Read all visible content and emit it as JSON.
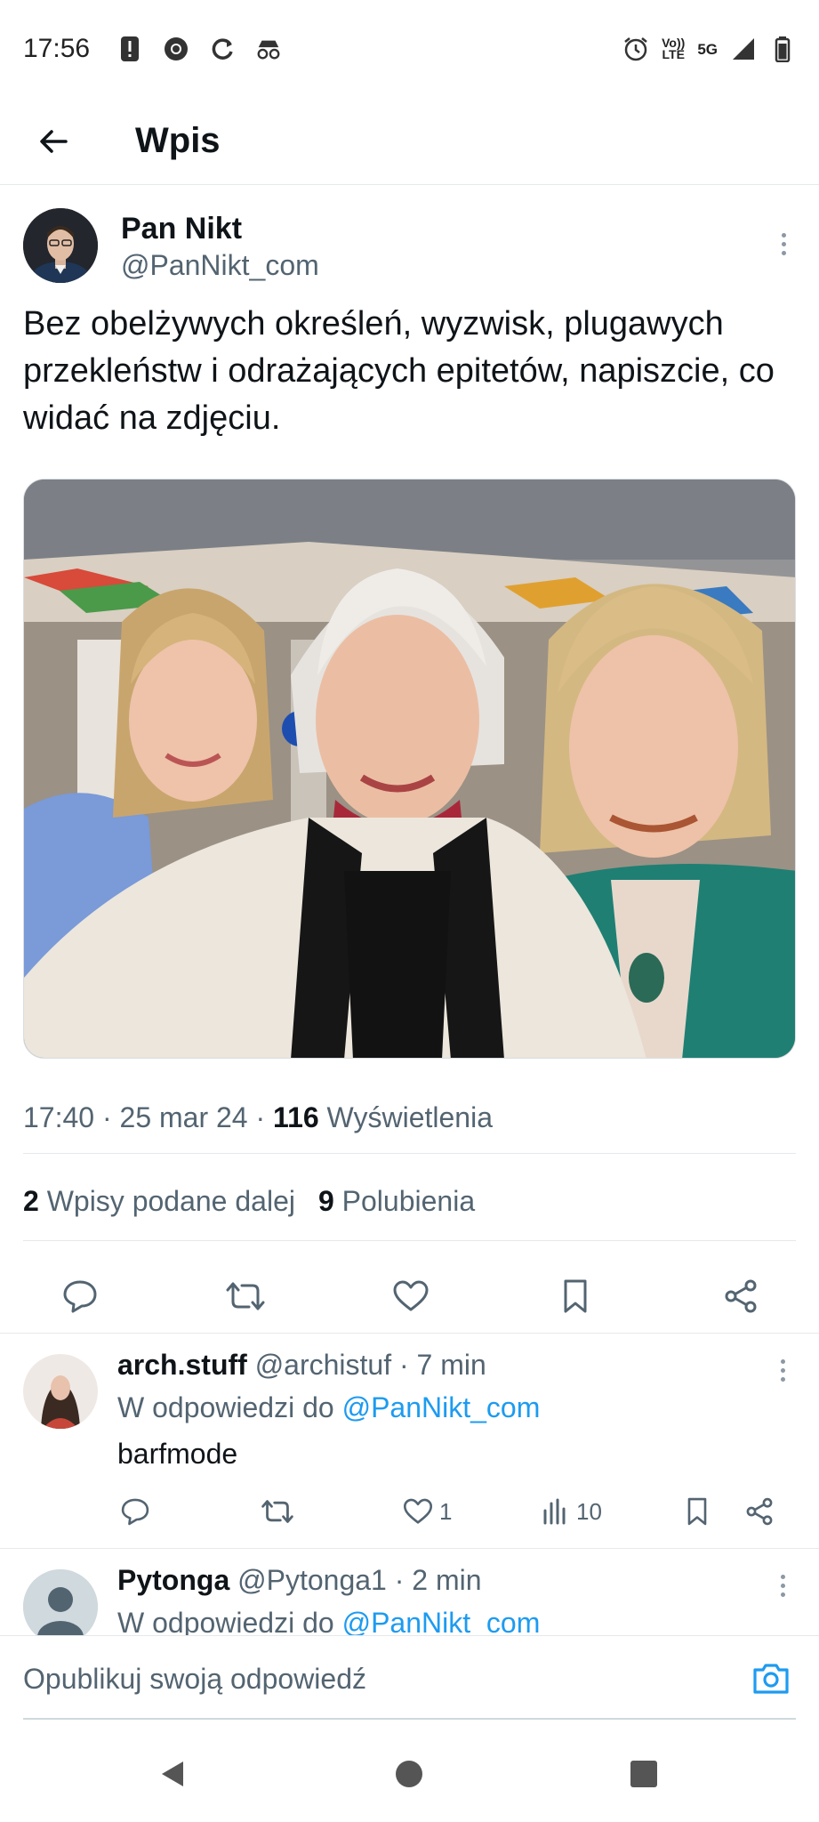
{
  "status_bar": {
    "time": "17:56",
    "network_top": "Vo))",
    "network_bottom": "LTE",
    "signal_label": "5G"
  },
  "header": {
    "title": "Wpis"
  },
  "post": {
    "author_name": "Pan Nikt",
    "author_handle": "@PanNikt_com",
    "text": "Bez obelżywych określeń, wyzwisk, plugawych przekleństw i odrażających epitetów, napiszcie, co widać na zdjęciu.",
    "time": "17:40",
    "date": "25 mar 24",
    "views_count": "116",
    "views_label": "Wyświetlenia",
    "reposts_count": "2",
    "reposts_label": "Wpisy podane dalej",
    "likes_count": "9",
    "likes_label": "Polubienia",
    "separator": "·"
  },
  "replies": [
    {
      "name": "arch.stuff",
      "handle": "@archistuf",
      "age": "7 min",
      "reply_to_label": "W odpowiedzi do",
      "reply_to_handle": "@PanNikt_com",
      "text": "barfmode",
      "likes": "1",
      "views": "10"
    },
    {
      "name": "Pytonga",
      "handle": "@Pytonga1",
      "age": "2 min",
      "reply_to_label": "W odpowiedzi do",
      "reply_to_handle": "@PanNikt_com"
    }
  ],
  "composer": {
    "placeholder": "Opublikuj swoją odpowiedź"
  },
  "colors": {
    "accent": "#1d9bf0",
    "text_primary": "#0f1419",
    "text_secondary": "#536471",
    "divider": "#e6e9ec"
  },
  "icons": {
    "back": "arrow-left-icon",
    "reply": "speech-bubble-icon",
    "repost": "repost-arrows-icon",
    "like": "heart-icon",
    "bookmark": "bookmark-icon",
    "share": "share-nodes-icon",
    "views": "bar-chart-icon",
    "camera": "camera-icon"
  }
}
